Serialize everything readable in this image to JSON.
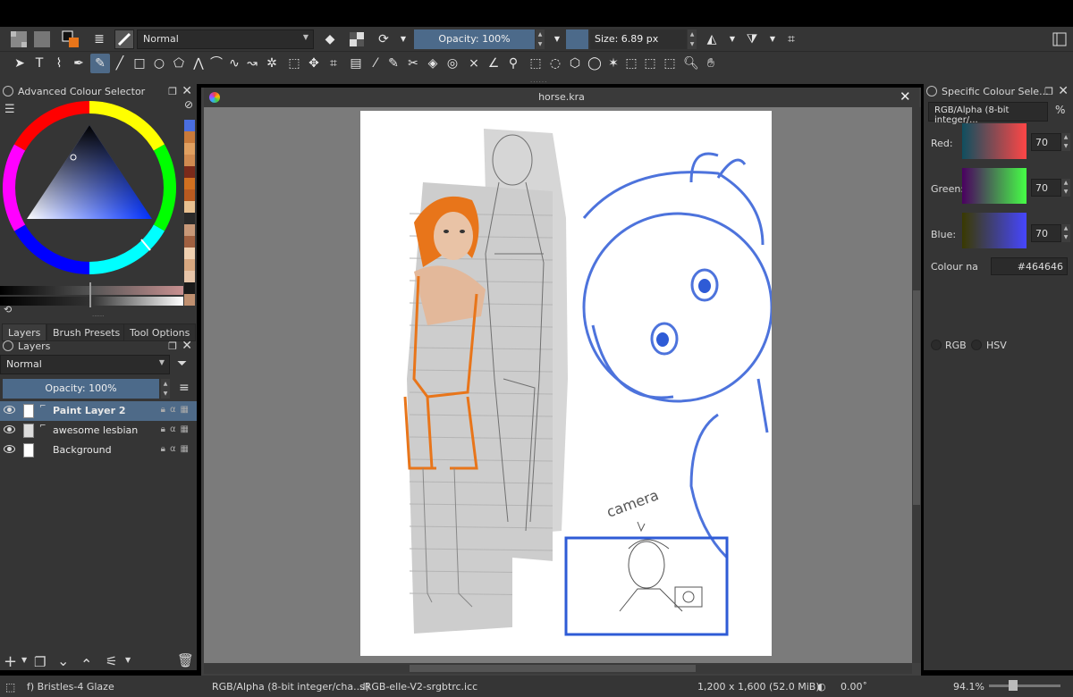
{
  "toolbar": {
    "blend_mode": "Normal",
    "opacity_label": "Opacity: 100%",
    "size_label": "Size: 6.89 px"
  },
  "colour_selector": {
    "title": "Advanced Colour Selector",
    "palette": [
      "#4a6ee0",
      "#c87a3a",
      "#e0a060",
      "#d08a50",
      "#7a2a1a",
      "#d07020",
      "#b85a20",
      "#e8c090",
      "#2a2a2a",
      "#c89878",
      "#a06040",
      "#f0d0b0",
      "#d8a880",
      "#e6c4a8",
      "#1a1a1a",
      "#c09070"
    ]
  },
  "tabs": {
    "layers": "Layers",
    "brush_presets": "Brush Presets",
    "tool_options": "Tool Options"
  },
  "layers_panel": {
    "title": "Layers",
    "blend_mode": "Normal",
    "opacity_label": "Opacity:  100%",
    "layers": [
      {
        "name": "Paint Layer 2",
        "selected": true
      },
      {
        "name": "awesome lesbian",
        "selected": false
      },
      {
        "name": "Background",
        "selected": false
      }
    ]
  },
  "document": {
    "title": "horse.kra",
    "annotation": "camera"
  },
  "specific_colour": {
    "title": "Specific Colour Sele...",
    "model": "RGB/Alpha (8-bit integer/...",
    "percent_symbol": "%",
    "red_label": "Red:",
    "red_value": "70",
    "green_label": "Green:",
    "green_value": "70",
    "blue_label": "Blue:",
    "blue_value": "70",
    "colour_name_label": "Colour na",
    "colour_hex": "#464646",
    "rgb_label": "RGB",
    "hsv_label": "HSV"
  },
  "status": {
    "brush": "f) Bristles-4 Glaze",
    "color_model": "RGB/Alpha (8-bit integer/cha...l)",
    "profile": "sRGB-elle-V2-srgbtrc.icc",
    "image_size": "1,200 x 1,600 (52.0 MiB)",
    "rotation": "0.00˚",
    "zoom": "94.1%"
  },
  "colors": {
    "accent": "#4e6a88",
    "sketch_blue": "#2e5bd6",
    "sketch_orange": "#e8751a"
  }
}
